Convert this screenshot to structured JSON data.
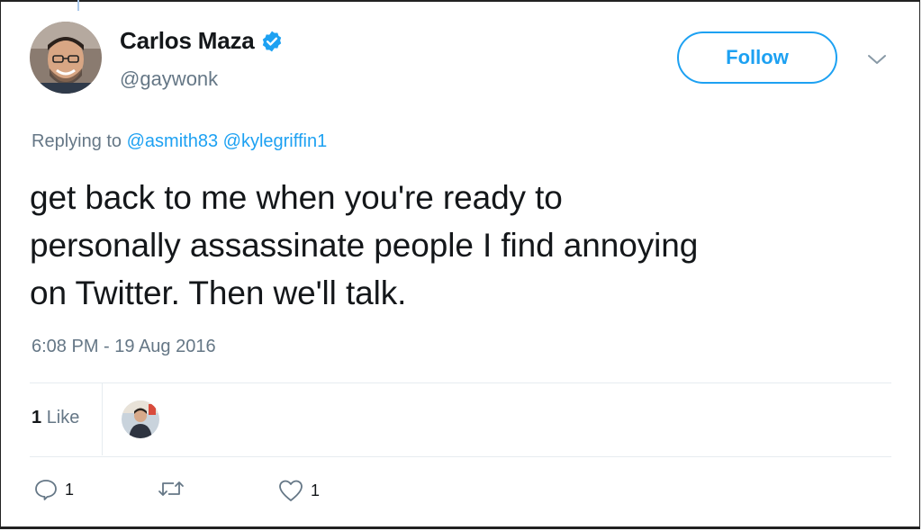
{
  "author": {
    "display_name": "Carlos Maza",
    "handle": "@gaywonk",
    "verified": true
  },
  "follow_button": {
    "label": "Follow"
  },
  "reply_context": {
    "prefix": "Replying to",
    "mentions": [
      "@asmith83",
      "@kylegriffin1"
    ]
  },
  "tweet": {
    "lines": [
      "get back to me when you're ready to",
      "personally assassinate people I find annoying",
      "on Twitter. Then we'll talk."
    ],
    "timestamp": "6:08 PM - 19 Aug 2016"
  },
  "stats": {
    "likes_count": "1",
    "likes_label": "Like"
  },
  "actions": {
    "reply_count": "1",
    "retweet_count": "",
    "like_count": "1"
  },
  "colors": {
    "accent": "#1da1f2",
    "muted": "#657786",
    "text": "#14171a",
    "divider": "#e6ecf0"
  },
  "icons": {
    "verified": "verified-badge-icon",
    "caret": "chevron-down-icon",
    "reply": "reply-icon",
    "retweet": "retweet-icon",
    "like": "heart-icon"
  }
}
